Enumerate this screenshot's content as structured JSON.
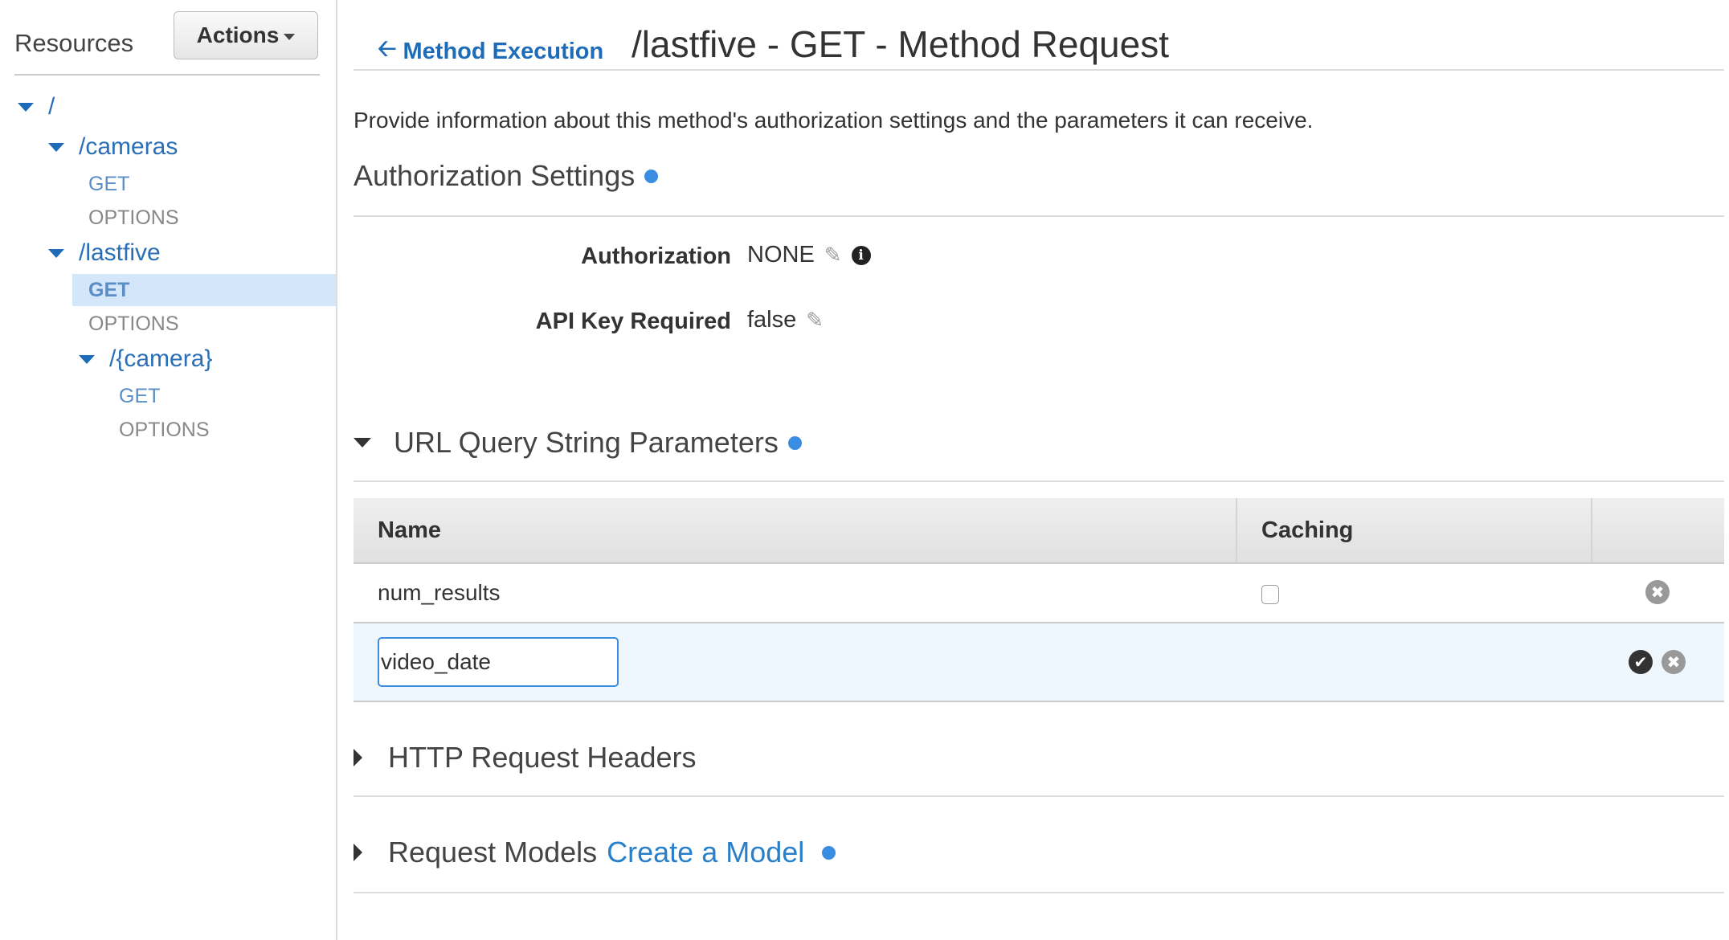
{
  "sidebar": {
    "title": "Resources",
    "actions_label": "Actions",
    "tree": {
      "root": "/",
      "cameras": "/cameras",
      "cameras_get": "GET",
      "cameras_options": "OPTIONS",
      "lastfive": "/lastfive",
      "lastfive_get": "GET",
      "lastfive_options": "OPTIONS",
      "camera": "/{camera}",
      "camera_get": "GET",
      "camera_options": "OPTIONS"
    },
    "selected": "/lastfive GET"
  },
  "header": {
    "back_label": "Method Execution",
    "title": "/lastfive - GET - Method Request"
  },
  "description": "Provide information about this method's authorization settings and the parameters it can receive.",
  "authorization_settings": {
    "title": "Authorization Settings",
    "authorization_label": "Authorization",
    "authorization_value": "NONE",
    "api_key_label": "API Key Required",
    "api_key_value": "false"
  },
  "query_params": {
    "title": "URL Query String Parameters",
    "expanded": true,
    "columns": [
      "Name",
      "Caching",
      ""
    ],
    "rows": [
      {
        "name": "num_results",
        "caching": false
      }
    ],
    "editing_row": {
      "value": "video_date"
    }
  },
  "http_headers": {
    "title": "HTTP Request Headers",
    "expanded": false
  },
  "request_models": {
    "title": "Request Models",
    "link": "Create a Model",
    "expanded": false
  },
  "colors": {
    "accent": "#1e6bb8",
    "link": "#2a7fc9",
    "info_dot": "#3a8de0",
    "selected_bg": "#d3e6fa"
  }
}
